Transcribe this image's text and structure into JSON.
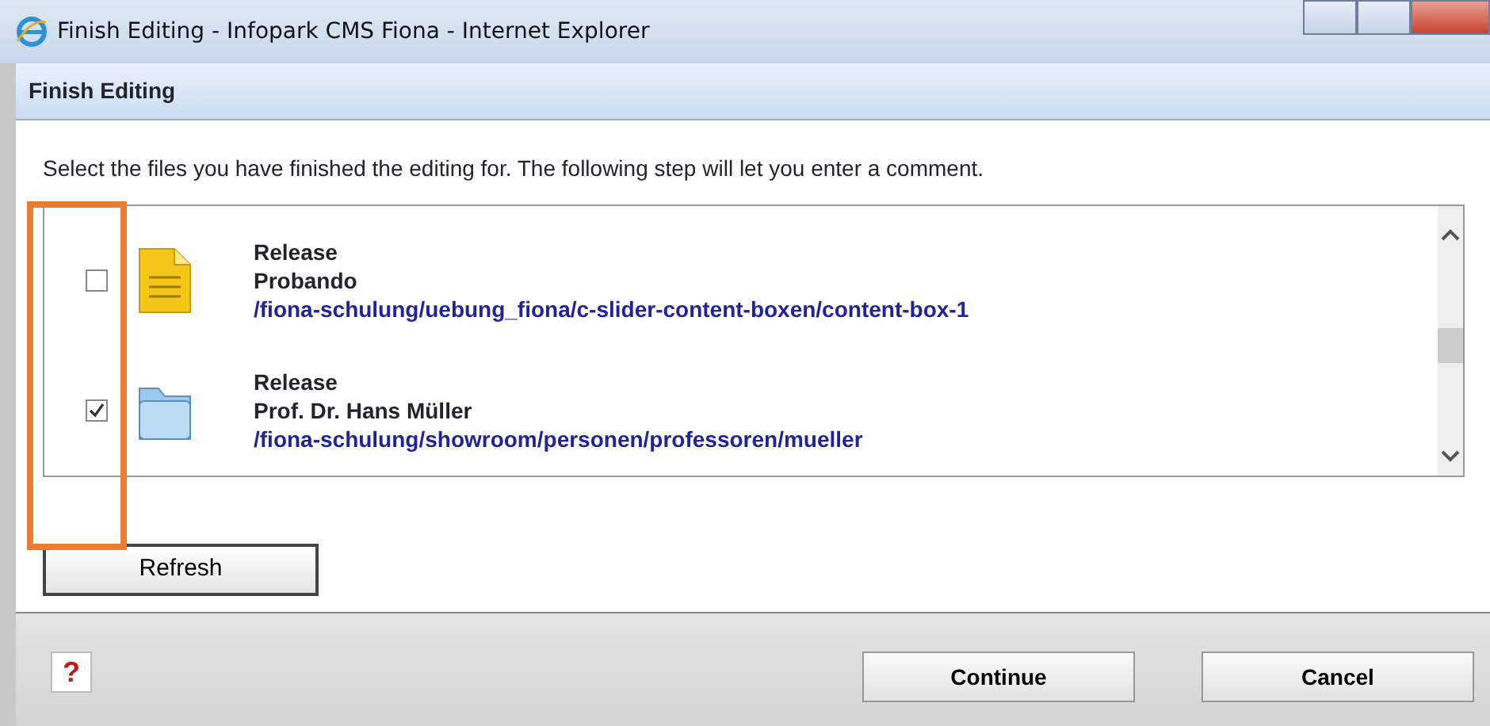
{
  "window": {
    "title": "Finish Editing - Infopark CMS Fiona - Internet Explorer"
  },
  "dialog": {
    "title": "Finish Editing",
    "instruction": "Select the files you have finished the editing for. The following step will let you enter a comment."
  },
  "files": [
    {
      "kind": "document",
      "action": "Release",
      "name": "Probando",
      "path": "/fiona-schulung/uebung_fiona/c-slider-content-boxen/content-box-1",
      "checked": false
    },
    {
      "kind": "folder",
      "action": "Release",
      "name": "Prof. Dr. Hans Müller",
      "path": "/fiona-schulung/showroom/personen/professoren/mueller",
      "checked": true
    }
  ],
  "refresh_button": "Refresh",
  "help_icon": "?",
  "buttons": [
    "Continue",
    "Cancel"
  ]
}
